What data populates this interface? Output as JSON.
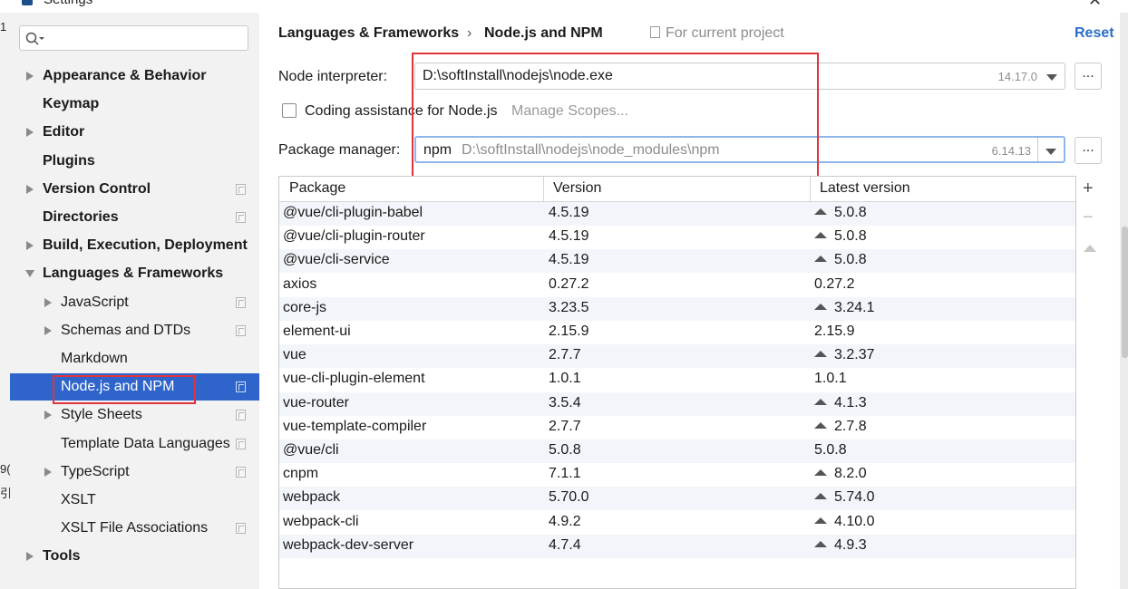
{
  "window": {
    "title": "Settings"
  },
  "sidebar": {
    "search_placeholder": "",
    "items": [
      {
        "label": "Appearance & Behavior",
        "bold": true,
        "arrow": "right",
        "proj": false
      },
      {
        "label": "Keymap",
        "bold": true,
        "arrow": "none",
        "proj": false
      },
      {
        "label": "Editor",
        "bold": true,
        "arrow": "right",
        "proj": false
      },
      {
        "label": "Plugins",
        "bold": true,
        "arrow": "none",
        "proj": false
      },
      {
        "label": "Version Control",
        "bold": true,
        "arrow": "right",
        "proj": true
      },
      {
        "label": "Directories",
        "bold": true,
        "arrow": "none",
        "proj": true
      },
      {
        "label": "Build, Execution, Deployment",
        "bold": true,
        "arrow": "right",
        "proj": false
      },
      {
        "label": "Languages & Frameworks",
        "bold": true,
        "arrow": "down",
        "proj": false
      },
      {
        "label": "JavaScript",
        "bold": false,
        "arrow": "right",
        "proj": true
      },
      {
        "label": "Schemas and DTDs",
        "bold": false,
        "arrow": "right",
        "proj": true
      },
      {
        "label": "Markdown",
        "bold": false,
        "arrow": "none",
        "proj": false
      },
      {
        "label": "Node.js and NPM",
        "bold": false,
        "arrow": "none",
        "proj": true,
        "selected": true
      },
      {
        "label": "Style Sheets",
        "bold": false,
        "arrow": "right",
        "proj": true
      },
      {
        "label": "Template Data Languages",
        "bold": false,
        "arrow": "none",
        "proj": true
      },
      {
        "label": "TypeScript",
        "bold": false,
        "arrow": "right",
        "proj": true
      },
      {
        "label": "XSLT",
        "bold": false,
        "arrow": "none",
        "proj": false
      },
      {
        "label": "XSLT File Associations",
        "bold": false,
        "arrow": "none",
        "proj": true
      },
      {
        "label": "Tools",
        "bold": true,
        "arrow": "right",
        "proj": false
      }
    ]
  },
  "header": {
    "breadcrumb_parent": "Languages & Frameworks",
    "breadcrumb_sep": "›",
    "breadcrumb_current": "Node.js and NPM",
    "for_project": "For current project",
    "reset": "Reset"
  },
  "node": {
    "label": "Node interpreter:",
    "value": "D:\\softInstall\\nodejs\\node.exe",
    "version": "14.17.0",
    "ellipsis": "..."
  },
  "coding": {
    "label": "Coding assistance for Node.js",
    "manage_scopes": "Manage Scopes..."
  },
  "package_manager": {
    "label": "Package manager:",
    "value": "npm",
    "path": "D:\\softInstall\\nodejs\\node_modules\\npm",
    "version": "6.14.13",
    "ellipsis": "..."
  },
  "table": {
    "headers": [
      "Package",
      "Version",
      "Latest version"
    ],
    "rows": [
      {
        "package": "@vue/cli-plugin-babel",
        "version": "4.5.19",
        "latest": "5.0.8",
        "upgrade": true
      },
      {
        "package": "@vue/cli-plugin-router",
        "version": "4.5.19",
        "latest": "5.0.8",
        "upgrade": true
      },
      {
        "package": "@vue/cli-service",
        "version": "4.5.19",
        "latest": "5.0.8",
        "upgrade": true
      },
      {
        "package": "axios",
        "version": "0.27.2",
        "latest": "0.27.2",
        "upgrade": false
      },
      {
        "package": "core-js",
        "version": "3.23.5",
        "latest": "3.24.1",
        "upgrade": true
      },
      {
        "package": "element-ui",
        "version": "2.15.9",
        "latest": "2.15.9",
        "upgrade": false
      },
      {
        "package": "vue",
        "version": "2.7.7",
        "latest": "3.2.37",
        "upgrade": true
      },
      {
        "package": "vue-cli-plugin-element",
        "version": "1.0.1",
        "latest": "1.0.1",
        "upgrade": false
      },
      {
        "package": "vue-router",
        "version": "3.5.4",
        "latest": "4.1.3",
        "upgrade": true
      },
      {
        "package": "vue-template-compiler",
        "version": "2.7.7",
        "latest": "2.7.8",
        "upgrade": true
      },
      {
        "package": "@vue/cli",
        "version": "5.0.8",
        "latest": "5.0.8",
        "upgrade": false
      },
      {
        "package": "cnpm",
        "version": "7.1.1",
        "latest": "8.2.0",
        "upgrade": true
      },
      {
        "package": "webpack",
        "version": "5.70.0",
        "latest": "5.74.0",
        "upgrade": true
      },
      {
        "package": "webpack-cli",
        "version": "4.9.2",
        "latest": "4.10.0",
        "upgrade": true
      },
      {
        "package": "webpack-dev-server",
        "version": "4.7.4",
        "latest": "4.9.3",
        "upgrade": true
      }
    ]
  },
  "tools": {
    "add": "+",
    "remove": "−"
  },
  "fringe": [
    "1",
    "9(",
    "引"
  ]
}
